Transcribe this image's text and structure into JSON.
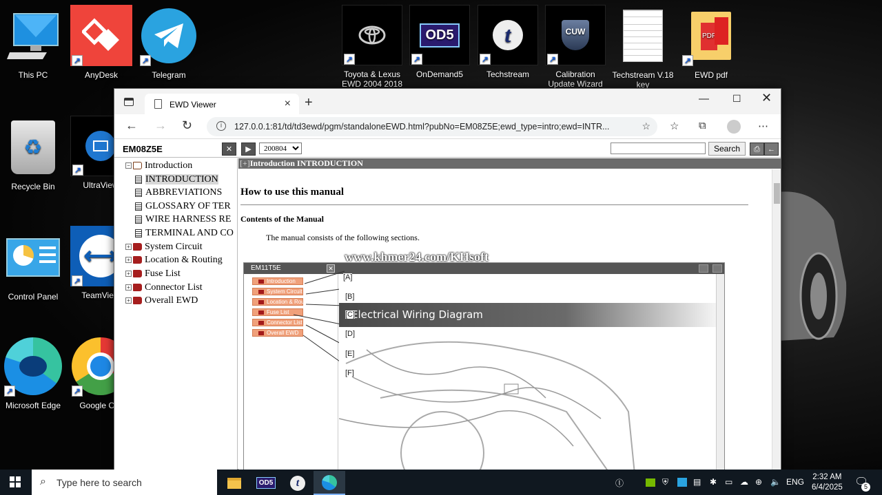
{
  "desktop": {
    "icons": [
      {
        "label": "This PC"
      },
      {
        "label": "AnyDesk"
      },
      {
        "label": "Telegram"
      },
      {
        "label": "Toyota & Lexus EWD 2004 2018"
      },
      {
        "label": "OnDemand5"
      },
      {
        "label": "Techstream"
      },
      {
        "label": "Calibration Update Wizard"
      },
      {
        "label": "Techstream V.18 key"
      },
      {
        "label": "EWD pdf"
      },
      {
        "label": "Recycle Bin"
      },
      {
        "label": "UltraView"
      },
      {
        "label": "Control Panel"
      },
      {
        "label": "TeamView"
      },
      {
        "label": "Microsoft Edge"
      },
      {
        "label": "Google Chr"
      }
    ],
    "glyphs": {
      "od5": "OD5",
      "techstream": "t",
      "cuw": "CUW",
      "pdf": "PDF"
    }
  },
  "browser": {
    "tab_title": "EWD Viewer",
    "url": "127.0.0.1:81/td/td3ewd/pgm/standaloneEWD.html?pubNo=EM08Z5E;ewd_type=intro;ewd=INTR..."
  },
  "ewd": {
    "doc_id": "EM08Z5E",
    "version": "200804",
    "search_label": "Search",
    "search_value": "",
    "tree": [
      {
        "label": "Introduction",
        "type": "open-book",
        "expander": "−"
      },
      {
        "label": "INTRODUCTION",
        "type": "doc"
      },
      {
        "label": "ABBREVIATIONS",
        "type": "doc"
      },
      {
        "label": "GLOSSARY OF TER",
        "type": "doc"
      },
      {
        "label": "WIRE HARNESS RE",
        "type": "doc"
      },
      {
        "label": "TERMINAL AND CO",
        "type": "doc"
      },
      {
        "label": "System Circuit",
        "type": "book",
        "expander": "+"
      },
      {
        "label": "Location & Routing",
        "type": "book",
        "expander": "+"
      },
      {
        "label": "Fuse List",
        "type": "book",
        "expander": "+"
      },
      {
        "label": "Connector List",
        "type": "book",
        "expander": "+"
      },
      {
        "label": "Overall EWD",
        "type": "book",
        "expander": "+"
      }
    ],
    "content": {
      "header_prefix": "[+]",
      "header_text": "Introduction  INTRODUCTION",
      "h1": "How to use this manual",
      "h2": "Contents of the Manual",
      "paragraph": "The manual consists of the following sections.",
      "figure": {
        "title": "EM11T5E",
        "banner": "Electrical Wiring Diagram",
        "tags": [
          "Introduction",
          "System Circuit",
          "Location & Routing",
          "Fuse List",
          "Connector List",
          "Overall EWD"
        ],
        "letters": [
          "[A]",
          "[B]",
          "[C]",
          "[D]",
          "[E]",
          "[F]"
        ],
        "watermark": "www.khmer24.com/KHsoft"
      }
    }
  },
  "taskbar": {
    "search_placeholder": "Type here to search",
    "od5": "OD5",
    "t": "t",
    "language": "ENG",
    "time": "2:32 AM",
    "date": "6/4/2025",
    "notification_count": "5"
  },
  "colors": {
    "anydesk": "#ef443b",
    "telegram": "#2aa3e0",
    "taskbar": "#101820",
    "tag": "#f0a07a",
    "ewd_header": "#6b6b6b"
  }
}
